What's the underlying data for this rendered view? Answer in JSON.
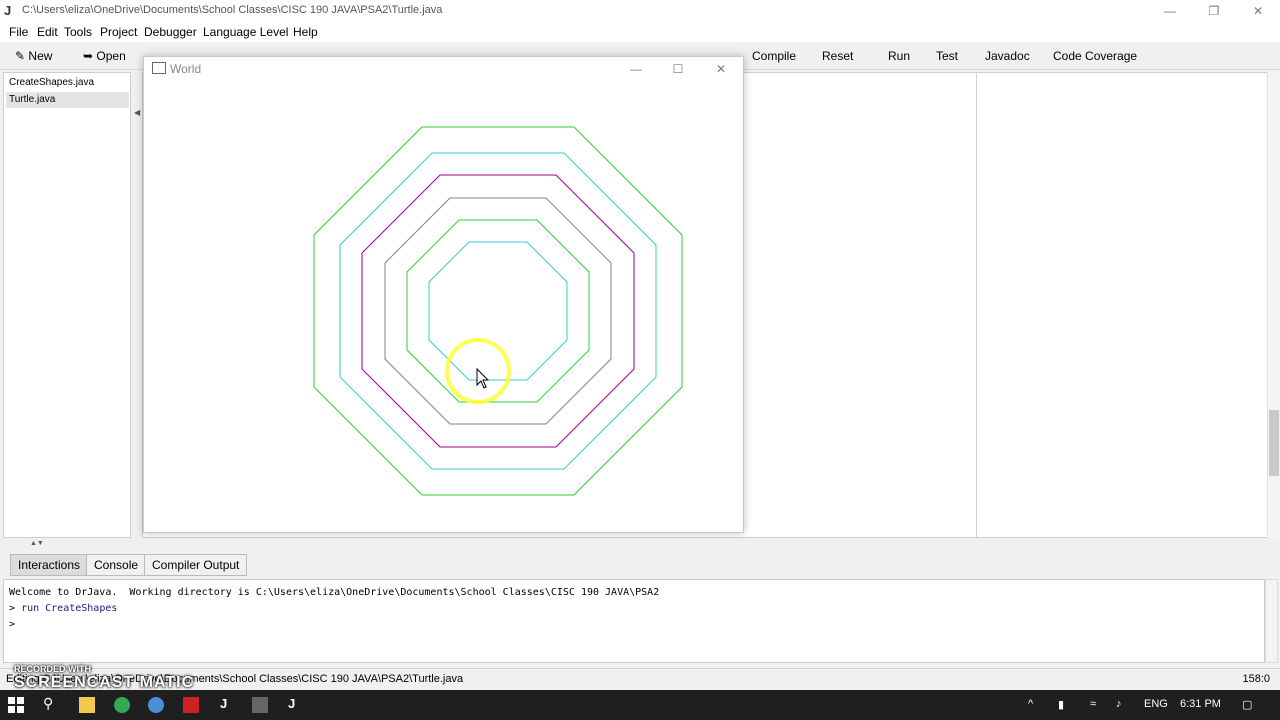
{
  "window": {
    "title": "C:\\Users\\eliza\\OneDrive\\Documents\\School Classes\\CISC 190 JAVA\\PSA2\\Turtle.java"
  },
  "menu": [
    "File",
    "Edit",
    "Tools",
    "Project",
    "Debugger",
    "Language Level",
    "Help"
  ],
  "toolbar": {
    "new_label": "New",
    "open_label": "Open",
    "compile_label": "Compile",
    "reset_label": "Reset",
    "run_label": "Run",
    "test_label": "Test",
    "javadoc_label": "Javadoc",
    "coverage_label": "Code Coverage"
  },
  "files": [
    "CreateShapes.java",
    "Turtle.java"
  ],
  "world": {
    "title": "World",
    "octagons": [
      {
        "color": "#33cc33"
      },
      {
        "color": "#33cccc"
      },
      {
        "color": "#990099"
      },
      {
        "color": "#808080"
      },
      {
        "color": "#33cc33"
      },
      {
        "color": "#33cccc"
      }
    ]
  },
  "tabs": [
    "Interactions",
    "Console",
    "Compiler Output"
  ],
  "console": {
    "line1": "Welcome to DrJava.  Working directory is C:\\Users\\eliza\\OneDrive\\Documents\\School Classes\\CISC 190 JAVA\\PSA2",
    "prompt": ">",
    "command": "run CreateShapes",
    "prompt2": ">"
  },
  "status": {
    "text": "Editing C:\\Users\\eliza\\OneDrive\\Documents\\School Classes\\CISC 190 JAVA\\PSA2\\Turtle.java",
    "position": "158:0"
  },
  "watermark": {
    "line1": "RECORDED WITH",
    "line2": "SCREENCAST MATIC"
  },
  "tray": {
    "lang": "ENG",
    "time": "6:31 PM"
  },
  "colors": {
    "cursor_highlight": "#ffff33"
  }
}
